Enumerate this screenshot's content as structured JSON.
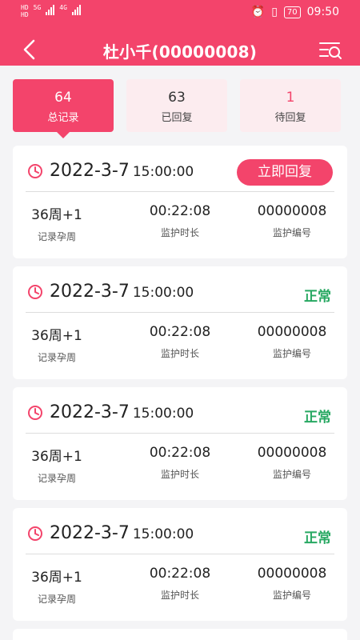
{
  "status_bar": {
    "left_indicators": [
      "HD",
      "HD"
    ],
    "net1": "5G",
    "net2": "4G",
    "battery": "70",
    "time": "09:50"
  },
  "nav": {
    "title": "杜小千(00000008)",
    "back_icon": "chevron-left-icon",
    "filter_icon": "filter-search-icon"
  },
  "tabs": [
    {
      "count": "64",
      "label": "总记录"
    },
    {
      "count": "63",
      "label": "已回复"
    },
    {
      "count": "1",
      "label": "待回复"
    }
  ],
  "records": [
    {
      "date": "2022-3-7",
      "time": "15:00:00",
      "action": "立即回复",
      "week": "36周+1",
      "week_label": "记录孕周",
      "duration": "00:22:08",
      "duration_label": "监护时长",
      "monitor_no": "00000008",
      "monitor_no_label": "监护编号"
    },
    {
      "date": "2022-3-7",
      "time": "15:00:00",
      "status": "正常",
      "week": "36周+1",
      "week_label": "记录孕周",
      "duration": "00:22:08",
      "duration_label": "监护时长",
      "monitor_no": "00000008",
      "monitor_no_label": "监护编号"
    },
    {
      "date": "2022-3-7",
      "time": "15:00:00",
      "status": "正常",
      "week": "36周+1",
      "week_label": "记录孕周",
      "duration": "00:22:08",
      "duration_label": "监护时长",
      "monitor_no": "00000008",
      "monitor_no_label": "监护编号"
    },
    {
      "date": "2022-3-7",
      "time": "15:00:00",
      "status": "正常",
      "week": "36周+1",
      "week_label": "记录孕周",
      "duration": "00:22:08",
      "duration_label": "监护时长",
      "monitor_no": "00000008",
      "monitor_no_label": "监护编号"
    }
  ],
  "colors": {
    "accent": "#f3446b",
    "normal": "#27a862",
    "tab_bg": "#fcecef"
  }
}
